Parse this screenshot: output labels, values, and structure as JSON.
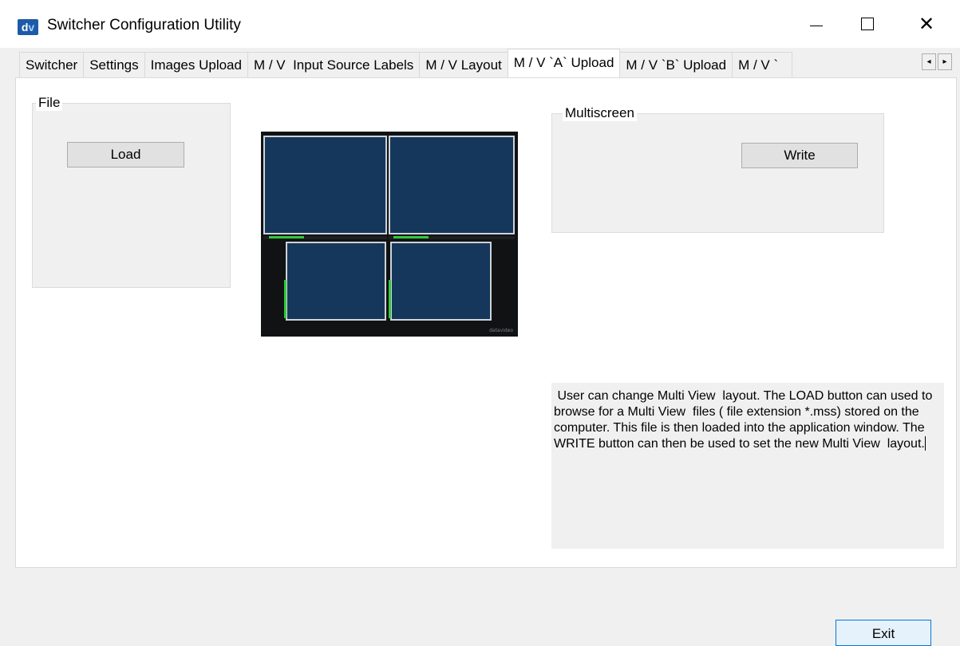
{
  "window": {
    "icon_text": "dv",
    "title": "Switcher Configuration Utility",
    "minimize_label": "",
    "maximize_label": "",
    "close_label": "✕"
  },
  "tabs": [
    {
      "label": "Switcher",
      "active": false
    },
    {
      "label": "Settings",
      "active": false
    },
    {
      "label": "Images Upload",
      "active": false
    },
    {
      "label": "M / V  Input Source Labels",
      "active": false
    },
    {
      "label": "M / V Layout",
      "active": false
    },
    {
      "label": "M / V `A` Upload",
      "active": true
    },
    {
      "label": "M / V `B` Upload",
      "active": false
    },
    {
      "label": "M / V `",
      "active": false
    }
  ],
  "tab_scroll": {
    "left": "◂",
    "right": "▸"
  },
  "file_group": {
    "title": "File",
    "load_label": "Load"
  },
  "multiscreen_group": {
    "title": "Multiscreen",
    "write_label": "Write"
  },
  "preview": {
    "logo_text": "datavideo",
    "pane_color": "#15375c",
    "meter_color": "#2fcb3a"
  },
  "info_text": " User can change Multi View  layout. The LOAD button can used to browse for a Multi View  files ( file extension *.mss) stored on the computer. This file is then loaded into the application window. The WRITE button can then be used to set the new Multi View  layout.",
  "exit_label": "Exit"
}
